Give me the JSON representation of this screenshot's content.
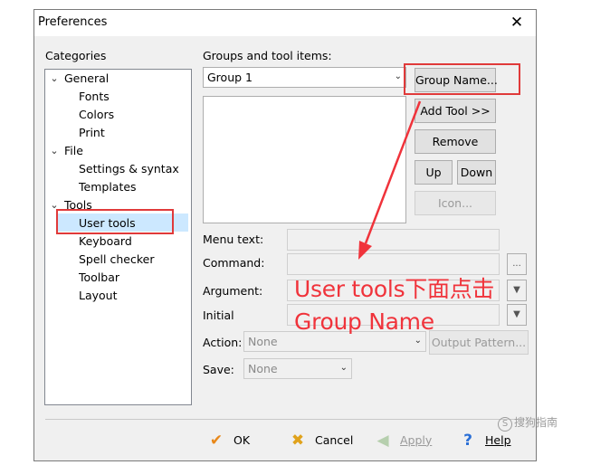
{
  "window": {
    "title": "Preferences",
    "close_glyph": "✕"
  },
  "categories": {
    "label": "Categories",
    "items": [
      {
        "label": "General",
        "toggle": "v"
      },
      {
        "label": "Fonts"
      },
      {
        "label": "Colors"
      },
      {
        "label": "Print"
      },
      {
        "label": "File",
        "toggle": "v"
      },
      {
        "label": "Settings & syntax"
      },
      {
        "label": "Templates"
      },
      {
        "label": "Tools",
        "toggle": "v"
      },
      {
        "label": "User tools",
        "selected": true
      },
      {
        "label": "Keyboard"
      },
      {
        "label": "Spell checker"
      },
      {
        "label": "Toolbar"
      },
      {
        "label": "Layout"
      }
    ]
  },
  "groups": {
    "label": "Groups and tool items:",
    "selected_group": "Group 1"
  },
  "buttons": {
    "group_name": "Group Name...",
    "add_tool": "Add Tool >>",
    "remove": "Remove",
    "up": "Up",
    "down": "Down",
    "icon": "Icon..."
  },
  "fields": {
    "menu_text_label": "Menu text:",
    "command_label": "Command:",
    "command_browse": "...",
    "argument_label": "Argument:",
    "initial_label": "Initial",
    "action_label": "Action:",
    "action_value": "None",
    "output_pattern": "Output Pattern...",
    "save_label": "Save:",
    "save_value": "None"
  },
  "annotation": {
    "line1": "User tools下面点击",
    "line2": "Group Name",
    "color": "#f0333b"
  },
  "footer": {
    "ok": "OK",
    "cancel": "Cancel",
    "apply": "Apply",
    "help": "Help"
  },
  "watermark": {
    "text": "搜狗指南"
  }
}
